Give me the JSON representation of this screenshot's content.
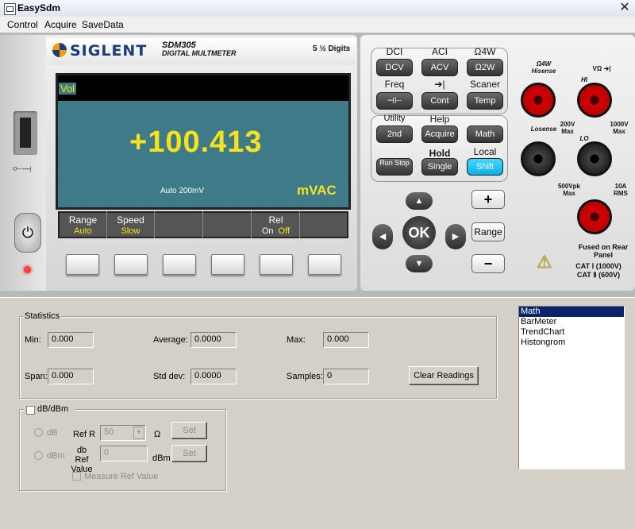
{
  "window": {
    "title": "EasySdm",
    "close_glyph": "✕"
  },
  "menu": [
    "Control",
    "Acquire",
    "SaveData"
  ],
  "device": {
    "brand": "SIGLENT",
    "model_line1": "SDM305",
    "model_line2": "DIGITAL MULTMETER",
    "digits": "5 ½ Digits",
    "screen": {
      "label": "Vol",
      "reading": "+100.413",
      "range_text": "Auto 200mV",
      "unit": "mVAC"
    },
    "softkeys": [
      {
        "label": "Range",
        "value": "Auto"
      },
      {
        "label": "Speed",
        "value": "Slow"
      },
      {
        "label": "",
        "value": ""
      },
      {
        "label": "",
        "value": ""
      },
      {
        "label": "Rel",
        "value_on": "On",
        "value_off": "Off"
      },
      {
        "label": "",
        "value": ""
      }
    ],
    "func_labels": {
      "dci": "DCI",
      "aci": "ACI",
      "o4w": "Ω4W",
      "freq": "Freq",
      "diode": "➔|",
      "scaner": "Scaner",
      "utility": "Utility",
      "help": "Help",
      "hold": "Hold",
      "local": "Local"
    },
    "func_keys": {
      "dcv": "DCV",
      "acv": "ACV",
      "o2w": "Ω2W",
      "cap": "⊣⊢",
      "cont": "Cont",
      "temp": "Temp",
      "second": "2nd",
      "acquire": "Acquire",
      "math": "Math",
      "run_stop": "Run Stop",
      "single": "Single",
      "shift": "Shift"
    },
    "nav": {
      "up": "▲",
      "down": "▼",
      "left": "◀",
      "right": "▶",
      "ok": "OK"
    },
    "range_keys": {
      "plus": "+",
      "range": "Range",
      "minus": "−"
    },
    "terminals": {
      "o4w_hisense": "Ω4W Hisense",
      "hi": "HI",
      "v_ohm": "VΩ ➔|",
      "lo": "LO",
      "losense": "Losense",
      "max200": "200V Max",
      "max1000": "1000V Max",
      "max500": "500Vpk Max",
      "rms10a": "10A RMS",
      "fused": "Fused on Rear Panel",
      "cat1": "CAT Ⅰ (1000V)",
      "cat2": "CAT Ⅱ (600V)"
    }
  },
  "statistics": {
    "title": "Statistics",
    "min_label": "Min:",
    "min": "0.000",
    "average_label": "Average:",
    "average": "0.0000",
    "max_label": "Max:",
    "max": "0.000",
    "span_label": "Span:",
    "span": "0.000",
    "stddev_label": "Std dev:",
    "stddev": "0.0000",
    "samples_label": "Samples:",
    "samples": "0",
    "clear_button": "Clear Readings"
  },
  "dbdbm": {
    "title": "dB/dBm",
    "db_radio": "dB",
    "dbm_radio": "dBm",
    "ref_r_label": "Ref R",
    "ref_r_value": "50",
    "ohm": "Ω",
    "set1": "Set",
    "db_ref_label_1": "db Ref",
    "db_ref_label_2": "Value",
    "db_ref_value": "0",
    "dbm_unit": "dBm",
    "set2": "Set",
    "measure_ref": "Measure Ref Value"
  },
  "list": [
    "Math",
    "BarMeter",
    "TrendChart",
    "Histongrom"
  ],
  "list_selected": "Math"
}
